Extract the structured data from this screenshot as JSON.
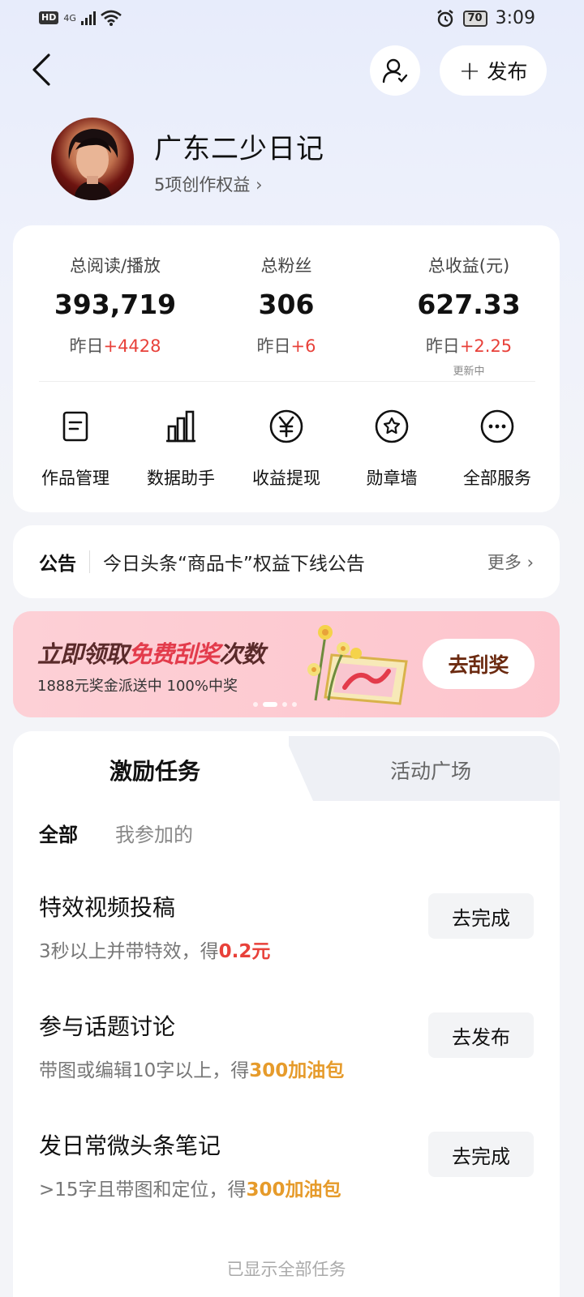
{
  "status_bar": {
    "hd": "HD",
    "network": "4G",
    "battery": "70",
    "time": "3:09"
  },
  "header": {
    "publish_label": "发布"
  },
  "profile": {
    "name": "广东二少日记",
    "rights": "5项创作权益"
  },
  "stats": [
    {
      "label": "总阅读/播放",
      "value": "393,719",
      "change_prefix": "昨日",
      "change": "+4428",
      "note": ""
    },
    {
      "label": "总粉丝",
      "value": "306",
      "change_prefix": "昨日",
      "change": "+6",
      "note": ""
    },
    {
      "label": "总收益(元)",
      "value": "627.33",
      "change_prefix": "昨日",
      "change": "+2.25",
      "note": "更新中"
    }
  ],
  "services": [
    {
      "label": "作品管理",
      "icon": "document-icon"
    },
    {
      "label": "数据助手",
      "icon": "bar-chart-icon"
    },
    {
      "label": "收益提现",
      "icon": "yuan-icon"
    },
    {
      "label": "勋章墙",
      "icon": "medal-icon"
    },
    {
      "label": "全部服务",
      "icon": "more-icon"
    }
  ],
  "notice": {
    "tag": "公告",
    "text": "今日头条“商品卡”权益下线公告",
    "more": "更多"
  },
  "banner": {
    "title_a": "立即领取",
    "title_b": "免费刮奖",
    "title_c": "次数",
    "subtitle": "1888元奖金派送中 100%中奖",
    "button": "去刮奖",
    "active_slide": 2,
    "slides": 4
  },
  "tasks": {
    "tab_active": "激励任务",
    "tab_inactive": "活动广场",
    "filter_all": "全部",
    "filter_mine": "我参加的",
    "items": [
      {
        "title": "特效视频投稿",
        "desc": "3秒以上并带特效，得",
        "reward": "0.2元",
        "reward_color": "red",
        "button": "去完成"
      },
      {
        "title": "参与话题讨论",
        "desc": "带图或编辑10字以上，得",
        "reward": "300加油包",
        "reward_color": "gold",
        "button": "去发布"
      },
      {
        "title": "发日常微头条笔记",
        "desc": ">15字且带图和定位，得",
        "reward": "300加油包",
        "reward_color": "gold",
        "button": "去完成"
      }
    ],
    "footer": "已显示全部任务"
  }
}
